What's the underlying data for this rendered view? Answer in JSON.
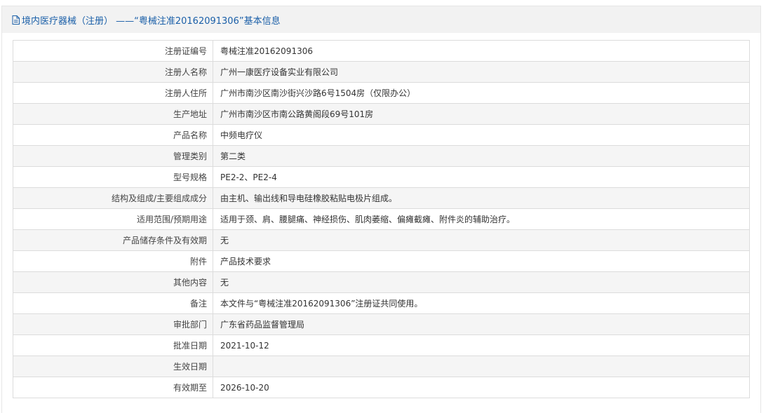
{
  "header": {
    "title": "境内医疗器械（注册） ——“粤械注准20162091306”基本信息"
  },
  "rows": [
    {
      "label": "注册证编号",
      "value": "粤械注准20162091306"
    },
    {
      "label": "注册人名称",
      "value": "广州一康医疗设备实业有限公司"
    },
    {
      "label": "注册人住所",
      "value": "广州市南沙区南沙街兴沙路6号1504房（仅限办公）"
    },
    {
      "label": "生产地址",
      "value": "广州市南沙区市南公路黄阁段69号101房"
    },
    {
      "label": "产品名称",
      "value": "中频电疗仪"
    },
    {
      "label": "管理类别",
      "value": "第二类"
    },
    {
      "label": "型号规格",
      "value": "PE2-2、PE2-4"
    },
    {
      "label": "结构及组成/主要组成成分",
      "value": "由主机、输出线和导电硅橡胶粘贴电极片组成。"
    },
    {
      "label": "适用范围/预期用途",
      "value": "适用于颈、肩、腰腿痛、神经损伤、肌肉萎缩、偏瘫截瘫、附件炎的辅助治疗。"
    },
    {
      "label": "产品储存条件及有效期",
      "value": "无"
    },
    {
      "label": "附件",
      "value": "产品技术要求"
    },
    {
      "label": "其他内容",
      "value": "无"
    },
    {
      "label": "备注",
      "value": "本文件与“粤械注准20162091306”注册证共同使用。"
    },
    {
      "label": "审批部门",
      "value": "广东省药品监督管理局"
    },
    {
      "label": "批准日期",
      "value": "2021-10-12"
    },
    {
      "label": "生效日期",
      "value": ""
    },
    {
      "label": "有效期至",
      "value": "2026-10-20"
    }
  ]
}
